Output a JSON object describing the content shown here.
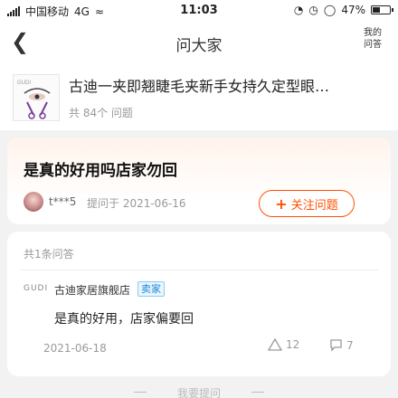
{
  "status": {
    "carrier": "中国移动",
    "network": "4G",
    "time": "11:03",
    "battery_pct": "47%",
    "battery_level": 0.47
  },
  "nav": {
    "back_icon": "chevron-left-icon",
    "title": "问大家",
    "mine_line1": "我的",
    "mine_line2": "问答"
  },
  "product": {
    "name": "古迪一夹即翘睫毛夹新手女持久定型眼…",
    "question_count": "共 84个 问题",
    "logo_text": "GUDI"
  },
  "question": {
    "text": "是真的好用吗店家勿回",
    "asker": "t***5",
    "asked_label": "提问于 2021-06-16",
    "follow_label": "关注问题"
  },
  "answers": {
    "count_label": "共1条问答",
    "items": [
      {
        "shop_logo": "GUDI",
        "shop": "古迪家居旗舰店",
        "badge": "卖家",
        "text": "是真的好用，店家偏要回",
        "date": "2021-06-18",
        "likes": "12",
        "comments": "7"
      }
    ]
  },
  "ask_bar": {
    "label": "我要提问"
  },
  "colors": {
    "accent": "#ff5000",
    "badge_blue": "#1c8ad8"
  }
}
